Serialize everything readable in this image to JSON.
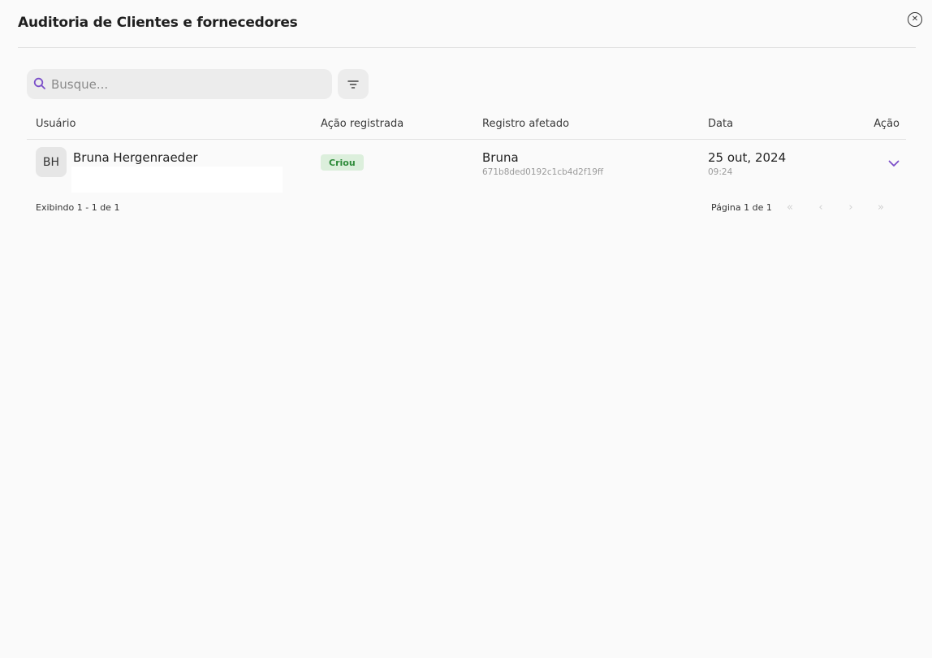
{
  "modal": {
    "title": "Auditoria de Clientes e fornecedores",
    "close_icon": "close-circle-icon"
  },
  "search": {
    "placeholder": "Busque...",
    "value": "",
    "icon": "search-icon"
  },
  "filter": {
    "icon": "filter-icon"
  },
  "table": {
    "headers": {
      "user": "Usuário",
      "action": "Ação registrada",
      "record": "Registro afetado",
      "date": "Data",
      "act": "Ação"
    },
    "rows": [
      {
        "avatar_initials": "BH",
        "user_name": "Bruna Hergenraeder",
        "action_badge": "Criou",
        "record_name": "Bruna",
        "record_id": "671b8ded0192c1cb4d2f19ff",
        "date": "25 out, 2024",
        "time": "09:24"
      }
    ]
  },
  "pagination": {
    "showing": "Exibindo 1 - 1 de 1",
    "page_info": "Página 1 de 1",
    "first_label": "«",
    "prev_label": "‹",
    "next_label": "›",
    "last_label": "»"
  },
  "colors": {
    "accent": "#7b4fc9",
    "badge_bg": "#dcefdc",
    "badge_text": "#2e8b3a"
  }
}
